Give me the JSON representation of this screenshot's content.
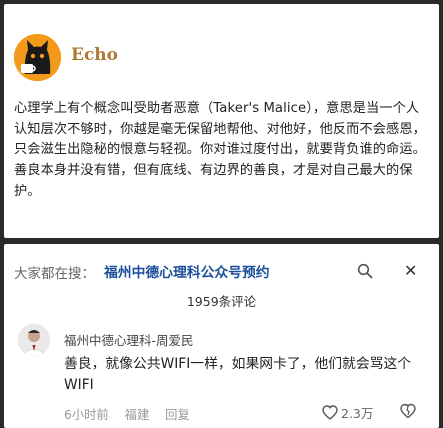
{
  "post": {
    "author": "Echo",
    "text": "心理学上有个概念叫受助者恶意（Taker's Malice），意思是当一个人认知层次不够时，你越是毫无保留地帮他、对他好，他反而不会感恩，只会滋生出隐秘的恨意与轻视。你对谁过度付出，就要背负谁的命运。善良本身并没有错，但有底线、有边界的善良，才是对自己最大的保护。"
  },
  "search": {
    "prefix": "大家都在搜：",
    "query": "福州中德心理科公众号预约"
  },
  "comments_header": {
    "count_label": "1959条评论"
  },
  "comment": {
    "author": "福州中德心理科-周爱民",
    "text": "善良，就像公共WIFI一样，如果网卡了，他们就会骂这个WIFI",
    "time": "6小时前",
    "location": "福建",
    "reply_label": "回复",
    "likes": "2.3万"
  },
  "colors": {
    "brand": "#b07a35",
    "link": "#1d4f9a",
    "avatar_bg": "#f39a1b"
  }
}
